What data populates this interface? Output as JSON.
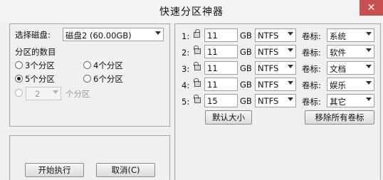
{
  "window": {
    "title": "快速分区神器",
    "close_glyph": "✕"
  },
  "left": {
    "disk_label": "选择磁盘:",
    "disk_value": "磁盘2 (60.00GB)",
    "count_label": "分区的数目",
    "radios": [
      {
        "label": "3个分区",
        "checked": false
      },
      {
        "label": "4个分区",
        "checked": false
      },
      {
        "label": "5个分区",
        "checked": true
      },
      {
        "label": "6个分区",
        "checked": false
      }
    ],
    "custom_value": "2",
    "custom_suffix": "个分区"
  },
  "partitions": [
    {
      "index": "1:",
      "size": "11",
      "unit": "GB",
      "fs": "NTFS",
      "vol_label": "卷标:",
      "name": "系统",
      "lock_icon": "lock-closed-icon"
    },
    {
      "index": "2:",
      "size": "11",
      "unit": "GB",
      "fs": "NTFS",
      "vol_label": "卷标:",
      "name": "软件",
      "lock_icon": "lock-open-icon"
    },
    {
      "index": "3:",
      "size": "11",
      "unit": "GB",
      "fs": "NTFS",
      "vol_label": "卷标:",
      "name": "文档",
      "lock_icon": "lock-open-icon"
    },
    {
      "index": "4:",
      "size": "11",
      "unit": "GB",
      "fs": "NTFS",
      "vol_label": "卷标:",
      "name": "娱乐",
      "lock_icon": "lock-open-icon"
    },
    {
      "index": "5:",
      "size": "15",
      "unit": "GB",
      "fs": "NTFS",
      "vol_label": "卷标:",
      "name": "其它",
      "lock_icon": "lock-open-icon"
    }
  ],
  "buttons": {
    "default_size": "默认大小",
    "remove_labels": "移除所有卷标",
    "start": "开始执行",
    "cancel": "取消(C)"
  },
  "colors": {
    "close_bg": "#c75050",
    "window_bg": "#f0f0f0"
  }
}
